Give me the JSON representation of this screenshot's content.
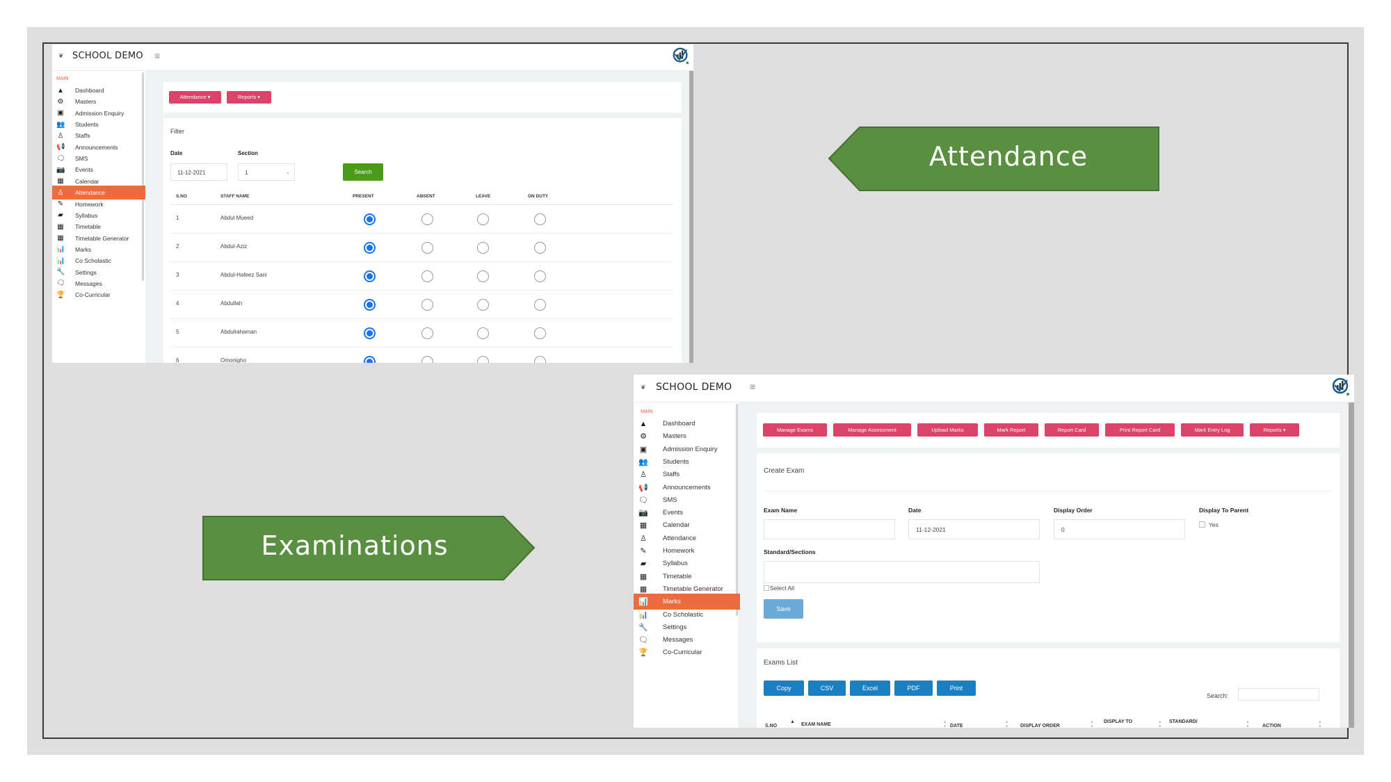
{
  "slide": {
    "labels": {
      "attendance": "Attendance",
      "examinations": "Examinations"
    },
    "colors": {
      "label_green": "#5a8f41",
      "label_green_border": "#44712e",
      "sidebar_active": "#ec6b3f",
      "pink_button": "#d94468",
      "blue_button": "#1a7fc3",
      "search_green": "#4b9b1a",
      "save_blue": "#6aaad8",
      "radio_blue": "#1a73e8"
    }
  },
  "attendance_window": {
    "brand": {
      "logo_icon": "school-logo-icon",
      "title": "SCHOOL DEMO"
    },
    "menu_icon": "hamburger-icon",
    "sidebar": {
      "section_label": "MAIN",
      "items": [
        {
          "label": "Dashboard",
          "icon": "▲",
          "active": false
        },
        {
          "label": "Masters",
          "icon": "⚙",
          "active": false
        },
        {
          "label": "Admission Enquiry",
          "icon": "▣",
          "active": false
        },
        {
          "label": "Students",
          "icon": "👥",
          "active": false
        },
        {
          "label": "Staffs",
          "icon": "♙",
          "active": false
        },
        {
          "label": "Announcements",
          "icon": "📢",
          "active": false
        },
        {
          "label": "SMS",
          "icon": "🗨",
          "active": false
        },
        {
          "label": "Events",
          "icon": "📷",
          "active": false
        },
        {
          "label": "Calendar",
          "icon": "▦",
          "active": false
        },
        {
          "label": "Attendance",
          "icon": "♙",
          "active": true
        },
        {
          "label": "Homework",
          "icon": "✎",
          "active": false
        },
        {
          "label": "Syllabus",
          "icon": "▰",
          "active": false
        },
        {
          "label": "Timetable",
          "icon": "▦",
          "active": false
        },
        {
          "label": "Timetable Generator",
          "icon": "▦",
          "active": false
        },
        {
          "label": "Marks",
          "icon": "📊",
          "active": false
        },
        {
          "label": "Co Scholastic",
          "icon": "📊",
          "active": false
        },
        {
          "label": "Settings",
          "icon": "🔧",
          "active": false
        },
        {
          "label": "Messages",
          "icon": "🗨",
          "active": false
        },
        {
          "label": "Co-Curricular",
          "icon": "🏆",
          "active": false
        }
      ]
    },
    "toolbar": {
      "attendance_button": "Attendance ▾",
      "reports_button": "Reports ▾"
    },
    "filter": {
      "title": "Filter",
      "date_label": "Date",
      "date_value": "11-12-2021",
      "section_label": "Section",
      "section_value": "1",
      "search_button": "Search"
    },
    "table": {
      "columns": [
        "S.NO",
        "STAFF NAME",
        "PRESENT",
        "ABSENT",
        "LEAVE",
        "ON DUTY"
      ],
      "rows": [
        {
          "sno": "1",
          "name": "Abdul Mueed",
          "status": "present"
        },
        {
          "sno": "2",
          "name": "Abdul-Aziz",
          "status": "present"
        },
        {
          "sno": "3",
          "name": "Abdul-Hafeez Sani",
          "status": "present"
        },
        {
          "sno": "4",
          "name": "Abdullah",
          "status": "present"
        },
        {
          "sno": "5",
          "name": "Abdulrahaman",
          "status": "present"
        },
        {
          "sno": "6",
          "name": "Omonigho",
          "status": "present"
        }
      ]
    }
  },
  "exam_window": {
    "brand": {
      "logo_icon": "school-logo-icon",
      "title": "SCHOOL DEMO"
    },
    "menu_icon": "hamburger-icon",
    "sidebar": {
      "section_label": "MAIN",
      "items": [
        {
          "label": "Dashboard",
          "icon": "▲",
          "active": false
        },
        {
          "label": "Masters",
          "icon": "⚙",
          "active": false
        },
        {
          "label": "Admission Enquiry",
          "icon": "▣",
          "active": false
        },
        {
          "label": "Students",
          "icon": "👥",
          "active": false
        },
        {
          "label": "Staffs",
          "icon": "♙",
          "active": false
        },
        {
          "label": "Announcements",
          "icon": "📢",
          "active": false
        },
        {
          "label": "SMS",
          "icon": "🗨",
          "active": false
        },
        {
          "label": "Events",
          "icon": "📷",
          "active": false
        },
        {
          "label": "Calendar",
          "icon": "▦",
          "active": false
        },
        {
          "label": "Attendance",
          "icon": "♙",
          "active": false
        },
        {
          "label": "Homework",
          "icon": "✎",
          "active": false
        },
        {
          "label": "Syllabus",
          "icon": "▰",
          "active": false
        },
        {
          "label": "Timetable",
          "icon": "▦",
          "active": false
        },
        {
          "label": "Timetable Generator",
          "icon": "▦",
          "active": false
        },
        {
          "label": "Marks",
          "icon": "📊",
          "active": true
        },
        {
          "label": "Co Scholastic",
          "icon": "📊",
          "active": false
        },
        {
          "label": "Settings",
          "icon": "🔧",
          "active": false
        },
        {
          "label": "Messages",
          "icon": "🗨",
          "active": false
        },
        {
          "label": "Co-Curricular",
          "icon": "🏆",
          "active": false
        }
      ]
    },
    "toolbar": {
      "buttons": [
        "Manage Exams",
        "Manage Assessment",
        "Upload Marks",
        "Mark Report",
        "Report Card",
        "Print Report Card",
        "Mark Entry Log",
        "Reports ▾"
      ]
    },
    "create_exam": {
      "title": "Create Exam",
      "exam_name_label": "Exam Name",
      "exam_name_value": "",
      "date_label": "Date",
      "date_value": "11-12-2021",
      "display_order_label": "Display Order",
      "display_order_value": "0",
      "display_to_parent_label": "Display To Parent",
      "display_to_parent_option": "Yes",
      "standard_sections_label": "Standard/Sections",
      "select_all_label": "Select All",
      "save_button": "Save"
    },
    "exams_list": {
      "title": "Exams List",
      "export_buttons": [
        "Copy",
        "CSV",
        "Excel",
        "PDF",
        "Print"
      ],
      "search_label": "Search:",
      "search_value": "",
      "columns": [
        "S.NO",
        "EXAM NAME",
        "DATE",
        "DISPLAY ORDER",
        "DISPLAY TO",
        "STANDARD/",
        "ACTION"
      ]
    }
  }
}
